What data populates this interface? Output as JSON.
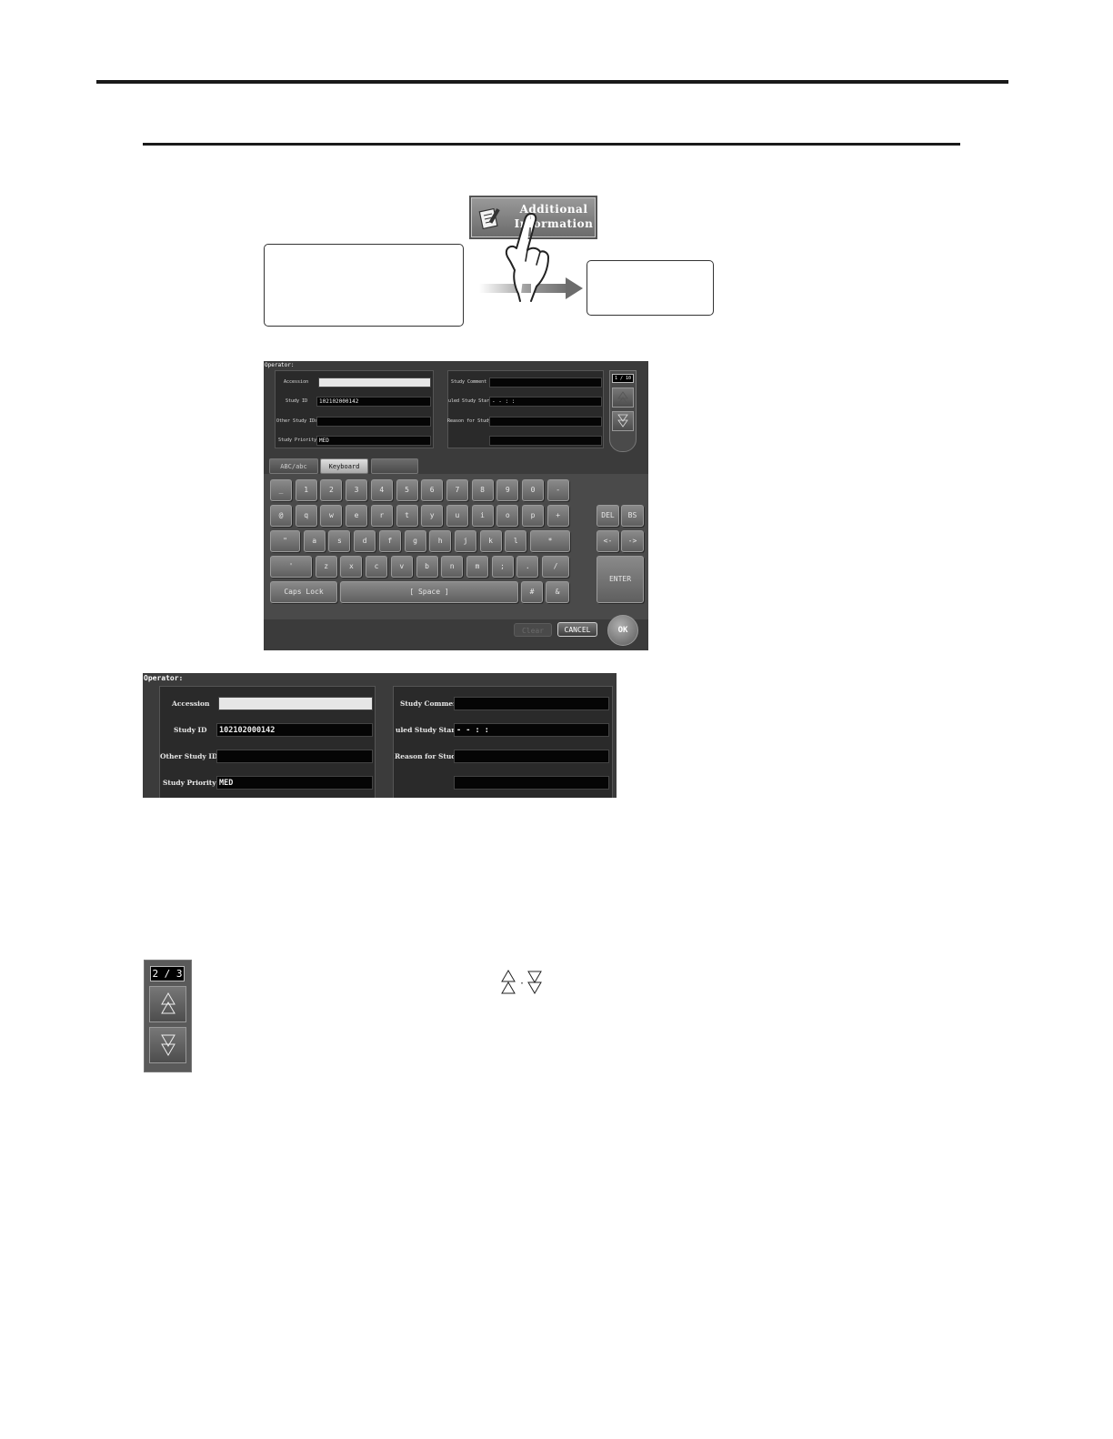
{
  "diagram": {
    "button_label_line1": "Additional",
    "button_label_line2": "Information",
    "button_icon": "clipboard-pencil-icon",
    "gesture_icon": "pointing-hand-icon"
  },
  "screen": {
    "operator_label": "Operator:",
    "fields_left": [
      {
        "label": "Accession",
        "value": ""
      },
      {
        "label": "Study ID",
        "value": "102102000142"
      },
      {
        "label": "Other Study IDs",
        "value": ""
      },
      {
        "label": "Study Priority",
        "value": "MED"
      }
    ],
    "fields_right": [
      {
        "label": "Study Comment",
        "value": ""
      },
      {
        "label": "uled Study Start",
        "value": "-  -        :  :"
      },
      {
        "label": "Reason for Study",
        "value": ""
      },
      {
        "label": "",
        "value": ""
      }
    ],
    "pager": {
      "count": "1 / 10"
    },
    "tabs": [
      "ABC/abc",
      "Keyboard",
      ""
    ],
    "keyboard_rows": [
      [
        "_",
        "1",
        "2",
        "3",
        "4",
        "5",
        "6",
        "7",
        "8",
        "9",
        "0",
        "-"
      ],
      [
        "@",
        "q",
        "w",
        "e",
        "r",
        "t",
        "y",
        "u",
        "i",
        "o",
        "p",
        "+"
      ],
      [
        "\"",
        "a",
        "s",
        "d",
        "f",
        "g",
        "h",
        "j",
        "k",
        "l",
        "*"
      ],
      [
        "'",
        "z",
        "x",
        "c",
        "v",
        "b",
        "n",
        "m",
        ";",
        ".",
        "/"
      ]
    ],
    "caps_lock": "Caps Lock",
    "space": "[ Space ]",
    "key_hash": "#",
    "key_amp": "&",
    "side_keys": {
      "del": "DEL",
      "bs": "BS",
      "left": "<-",
      "right": "->",
      "enter": "ENTER"
    },
    "footer": {
      "clear": "Clear",
      "cancel": "CANCEL",
      "ok": "OK"
    }
  },
  "zoom": {
    "operator_label": "Operator:",
    "fields_left": [
      {
        "label": "Accession",
        "value": ""
      },
      {
        "label": "Study ID",
        "value": "102102000142"
      },
      {
        "label": "Other Study IDs",
        "value": ""
      },
      {
        "label": "Study Priority",
        "value": "MED"
      }
    ],
    "fields_right": [
      {
        "label": "Study Comment",
        "value": ""
      },
      {
        "label": "uled Study Start",
        "value": "-  -        :  :"
      },
      {
        "label": "Reason for Study",
        "value": ""
      },
      {
        "label": "",
        "value": ""
      }
    ]
  },
  "pager_closeup": {
    "count": "2 / 3"
  },
  "inline_icons": {
    "separator": "·",
    "up": "page-up-icon",
    "down": "page-down-icon"
  }
}
